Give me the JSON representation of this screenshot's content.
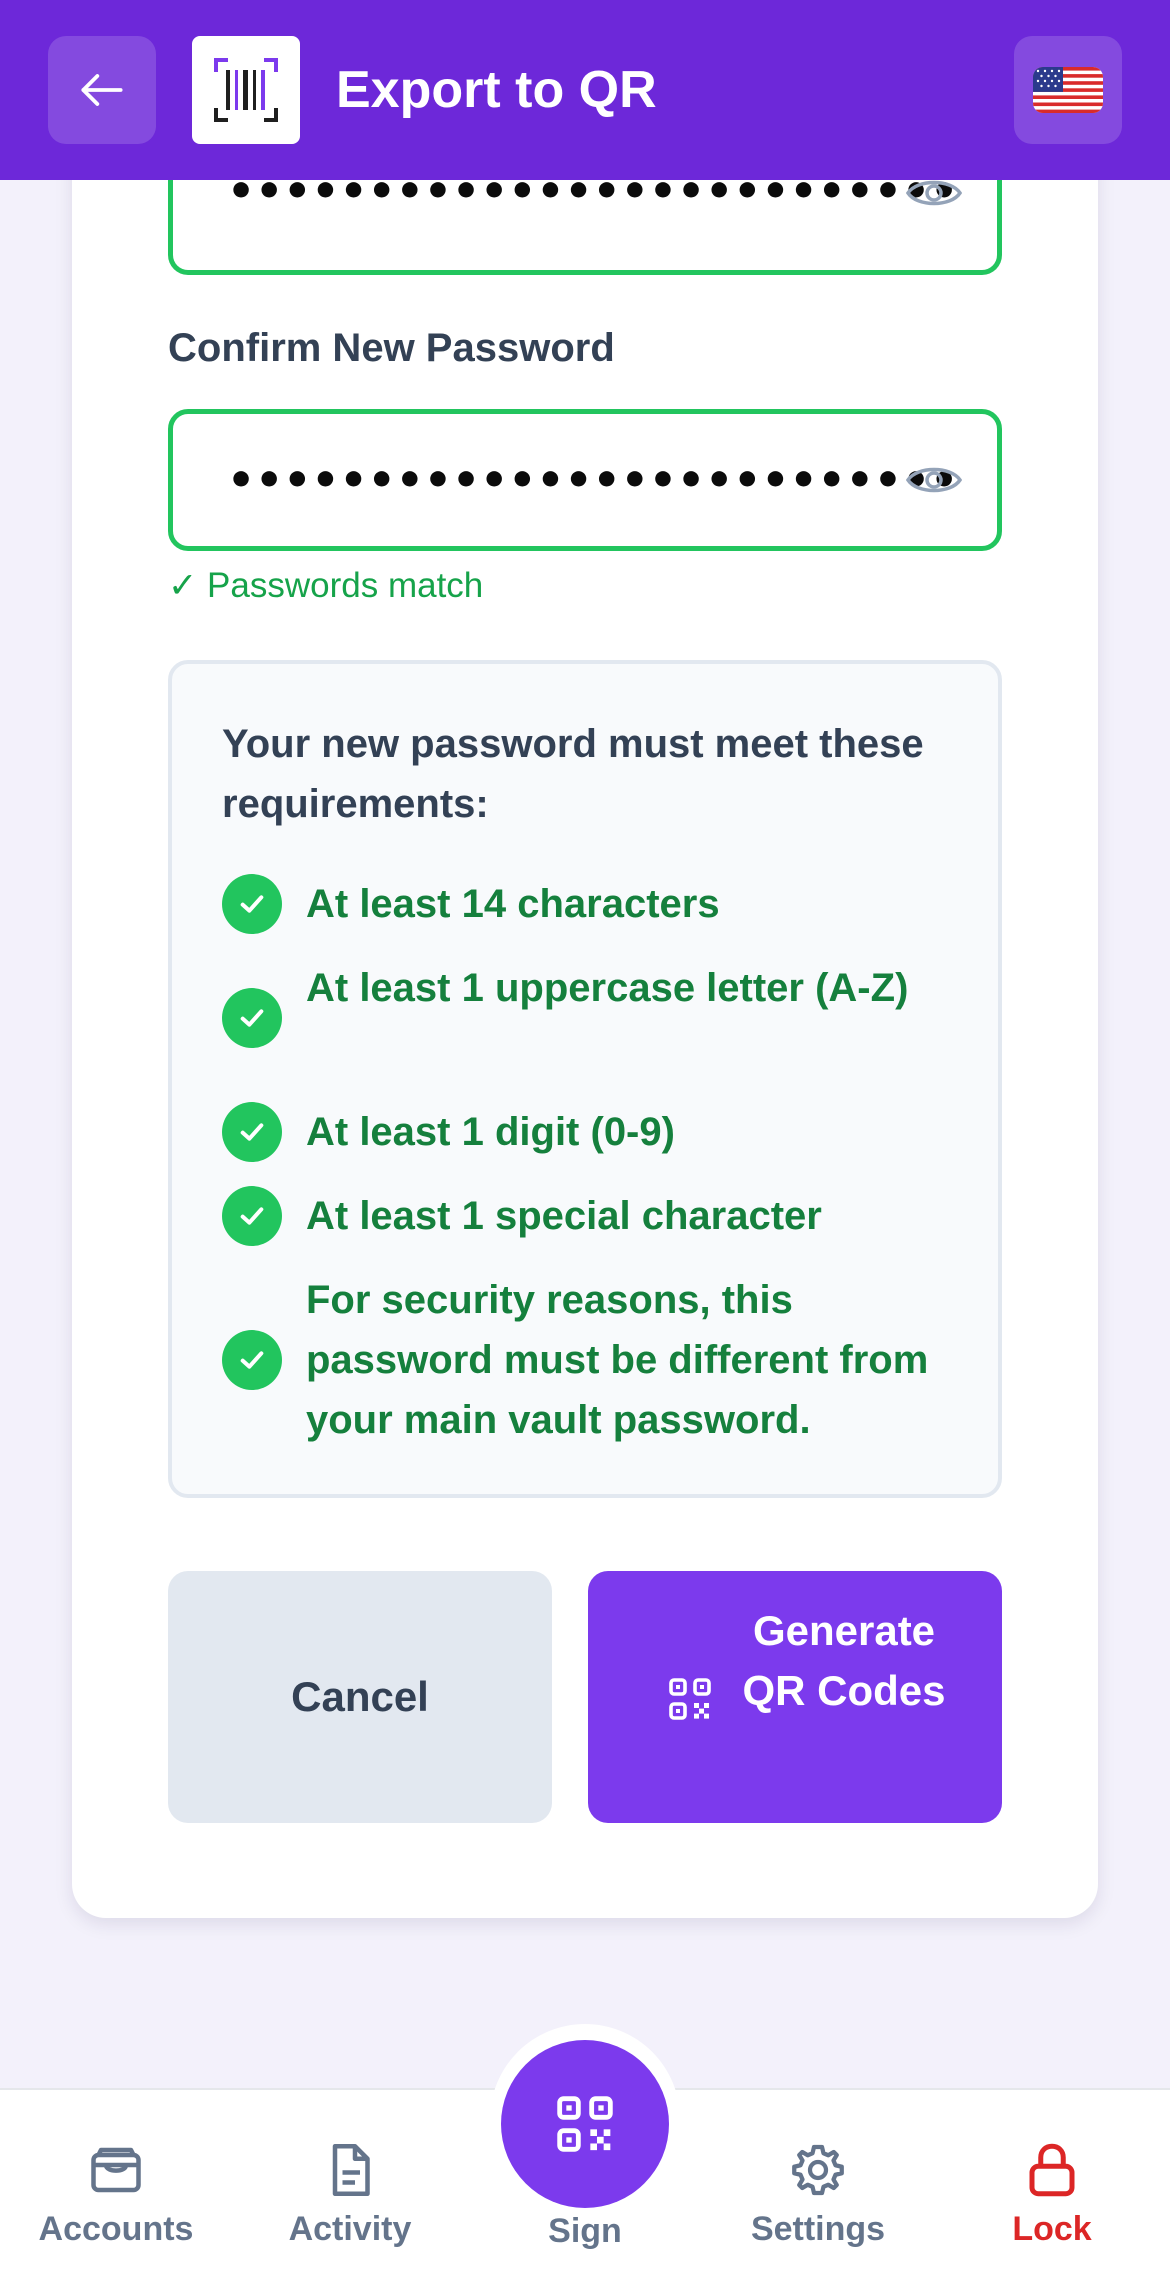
{
  "header": {
    "title": "Export to QR",
    "back_icon": "arrow-left-icon",
    "logo_icon": "barcode-scan-icon",
    "language_icon": "us-flag-icon",
    "accent": "#6D28D9"
  },
  "form": {
    "new_password_dots": "••••••••••••••••••••••••••",
    "confirm_label": "Confirm New Password",
    "confirm_password_dots": "••••••••••••••••••••••••••",
    "match_text": "✓ Passwords match",
    "success_color": "#22C55E"
  },
  "requirements": {
    "title": "Your new password must meet these requirements:",
    "items": [
      "At least 14 characters",
      "At least 1 uppercase letter (A-Z)",
      "At least 1 digit (0-9)",
      "At least 1 special character",
      "For security reasons, this password must be different from your main vault password."
    ]
  },
  "actions": {
    "cancel_label": "Cancel",
    "generate_label": "Generate QR Codes",
    "generate_icon": "qr-code-icon",
    "primary_color": "#7C3AED"
  },
  "bottom_nav": {
    "accounts": "Accounts",
    "activity": "Activity",
    "sign": "Sign",
    "settings": "Settings",
    "lock": "Lock",
    "lock_color": "#DC2626"
  }
}
